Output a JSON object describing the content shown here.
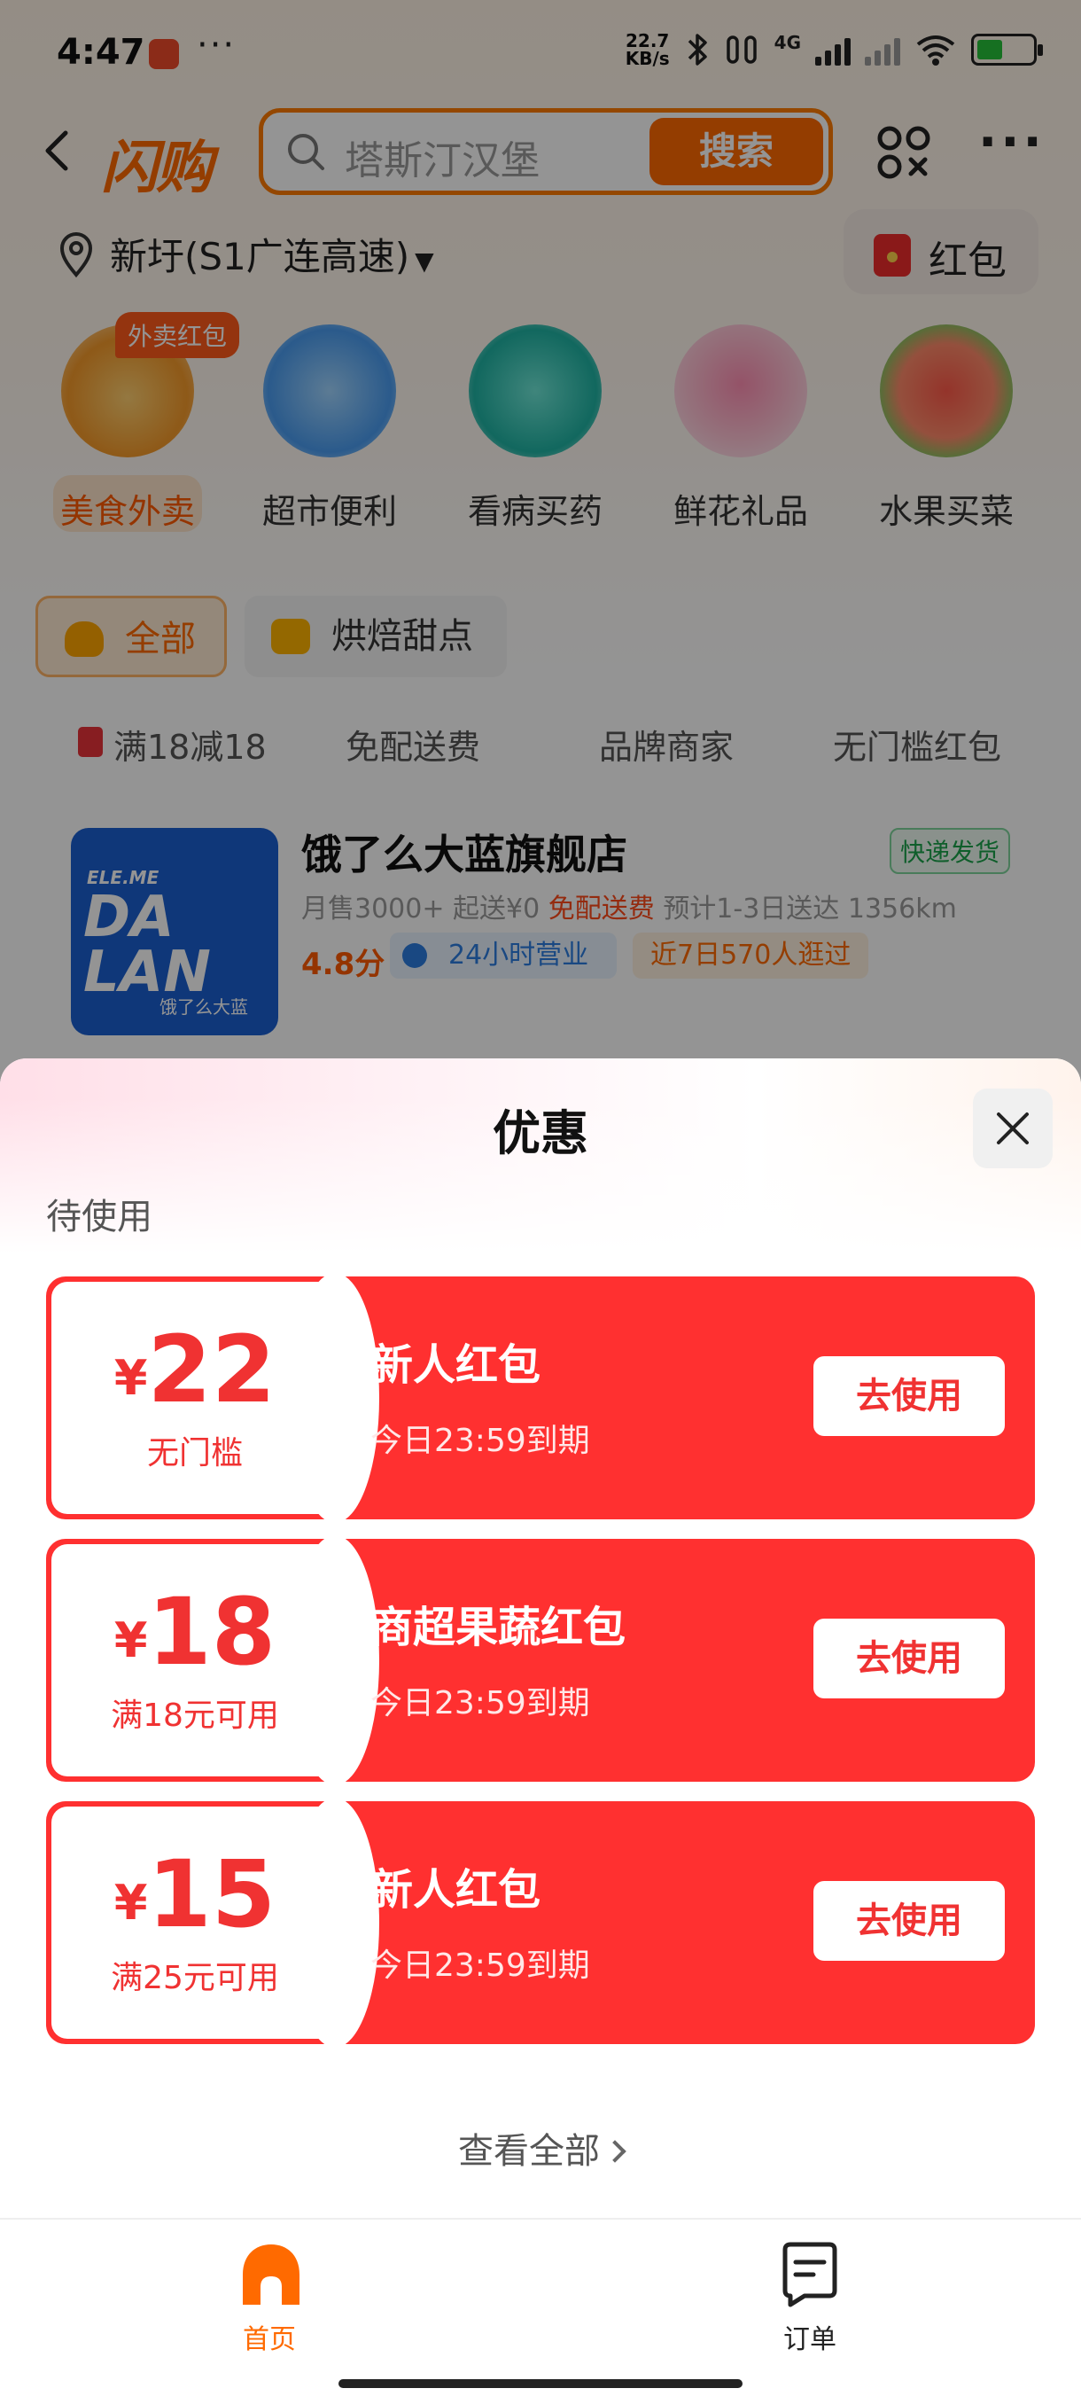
{
  "status_bar": {
    "time": "4:47",
    "more": "···",
    "speed_value": "22.7",
    "speed_unit": "KB/s",
    "network": "4G"
  },
  "topnav": {
    "logo": "闪购",
    "search_placeholder": "塔斯汀汉堡",
    "search_button": "搜索"
  },
  "location": {
    "text": "新圩(S1广连高速)",
    "hongbao_label": "红包"
  },
  "categories": [
    {
      "label": "美食外卖",
      "badge": "外卖红包",
      "color": "#ffb347"
    },
    {
      "label": "超市便利",
      "color": "#7fc4ff"
    },
    {
      "label": "看病买药",
      "color": "#37c8b8"
    },
    {
      "label": "鲜花礼品",
      "color": "#ffb0c8"
    },
    {
      "label": "水果买菜",
      "color": "#ff6b5a"
    }
  ],
  "filters": [
    {
      "label": "全部"
    },
    {
      "label": "烘焙甜点"
    }
  ],
  "tags": [
    "满18减18",
    "免配送费",
    "品牌商家",
    "无门槛红包"
  ],
  "store": {
    "name": "饿了么大蓝旗舰店",
    "logo_line1": "ELE.ME",
    "logo_line2": "DA",
    "logo_line3": "LAN",
    "logo_caption": "饿了么大蓝",
    "express_badge": "快递发货",
    "monthly_sales": "月售3000+",
    "min_order": "起送¥0",
    "free_delivery": "免配送费",
    "eta": "预计1-3日送达",
    "distance": "1356km",
    "rating": "4.8分",
    "hours": "24小时营业",
    "visits": "近7日570人逛过"
  },
  "sheet": {
    "title": "优惠",
    "section_label": "待使用",
    "view_all": "查看全部",
    "coupons": [
      {
        "currency": "¥",
        "amount": "22",
        "condition": "无门槛",
        "name": "新人红包",
        "expiry": "今日23:59到期",
        "button": "去使用"
      },
      {
        "currency": "¥",
        "amount": "18",
        "condition": "满18元可用",
        "name": "商超果蔬红包",
        "expiry": "今日23:59到期",
        "button": "去使用"
      },
      {
        "currency": "¥",
        "amount": "15",
        "condition": "满25元可用",
        "name": "新人红包",
        "expiry": "今日23:59到期",
        "button": "去使用"
      }
    ]
  },
  "tabbar": {
    "home_label": "首页",
    "orders_label": "订单"
  },
  "colors": {
    "accent": "#ff6a00",
    "coupon_red": "#ff3030"
  }
}
